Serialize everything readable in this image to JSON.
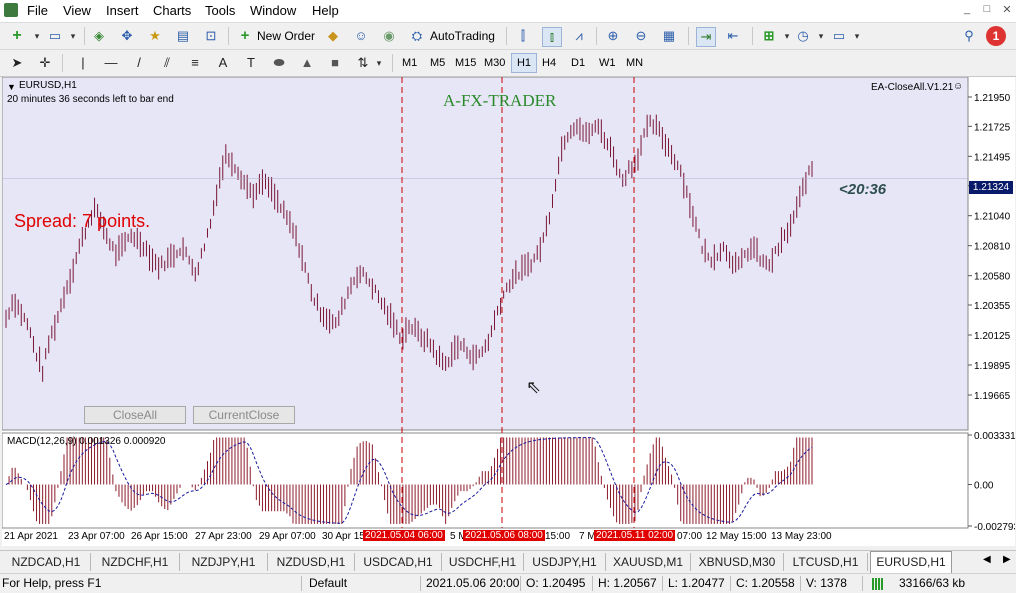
{
  "menu": {
    "items": [
      "File",
      "View",
      "Insert",
      "Charts",
      "Tools",
      "Window",
      "Help"
    ],
    "window_controls": [
      "_",
      "□",
      "✕"
    ]
  },
  "toolbar": {
    "new_order": "New Order",
    "autotrading": "AutoTrading",
    "notification_count": "1"
  },
  "timeframes": [
    "M1",
    "M5",
    "M15",
    "M30",
    "H1",
    "H4",
    "D1",
    "W1",
    "MN"
  ],
  "timeframe_active": "H1",
  "chart": {
    "symbol_label": "EURUSD,H1",
    "countdown": "20 minutes 36 seconds left to bar end",
    "watermark": "A-FX-TRADER",
    "ea_name": "EA-CloseAll.V1.21",
    "spread": "Spread: 7 points.",
    "timer": "<20:36",
    "close_all": "CloseAll",
    "current_close": "CurrentClose",
    "macd_label": "MACD(12,26,9) 0.001326 0.000920",
    "current_price": "1.21324",
    "price_ticks": [
      "1.21950",
      "1.21725",
      "1.21495",
      "1.21270",
      "1.21040",
      "1.20810",
      "1.20580",
      "1.20355",
      "1.20125",
      "1.19895",
      "1.19665"
    ],
    "macd_ticks": [
      "0.003331",
      "0.00",
      "-0.002793"
    ],
    "time_labels": [
      "21 Apr 2021",
      "23 Apr 07:00",
      "26 Apr 15:00",
      "27 Apr 23:00",
      "29 Apr 07:00",
      "30 Apr 15:00",
      "5 M",
      "15:00",
      "7 M",
      "07:00",
      "12 May 15:00",
      "13 May 23:00"
    ],
    "vline_labels": [
      "2021.05.04 06:00",
      "2021.05.06 08:00",
      "2021.05.11 02:00"
    ],
    "colors": {
      "bars": "#7a1535",
      "vline": "#cc0000",
      "watermark": "#2a8a2a",
      "spread": "#e00000",
      "timer": "#2f4f4f",
      "macd_hist": "#8b1a2a",
      "macd_signal": "#1a1aa0",
      "price_tag_bg": "#0a1a6a"
    }
  },
  "symbol_tabs": [
    "NZDCAD,H1",
    "NZDCHF,H1",
    "NZDJPY,H1",
    "NZDUSD,H1",
    "USDCAD,H1",
    "USDCHF,H1",
    "USDJPY,H1",
    "XAUUSD,M1",
    "XBNUSD,M30",
    "LTCUSD,H1",
    "EURUSD,H1"
  ],
  "symbol_tab_active": "EURUSD,H1",
  "status": {
    "help": "For Help, press F1",
    "profile": "Default",
    "datetime": "2021.05.06 20:00",
    "open": "O: 1.20495",
    "high": "H: 1.20567",
    "low": "L: 1.20477",
    "close": "C: 1.20558",
    "volume": "V: 1378",
    "traffic": "33166/63 kb"
  },
  "chart_data": {
    "type": "candlestick-bars",
    "title": "EURUSD,H1",
    "ylim": [
      1.19665,
      1.2195
    ],
    "price_path": [
      1.2025,
      1.204,
      1.203,
      1.202,
      1.2,
      1.1985,
      1.201,
      1.2025,
      1.2045,
      1.206,
      1.208,
      1.2095,
      1.211,
      1.21,
      1.2085,
      1.2075,
      1.208,
      1.209,
      1.2085,
      1.208,
      1.207,
      1.2065,
      1.207,
      1.2075,
      1.208,
      1.207,
      1.206,
      1.208,
      1.21,
      1.213,
      1.215,
      1.2145,
      1.2135,
      1.2125,
      1.212,
      1.213,
      1.2125,
      1.2115,
      1.2105,
      1.2095,
      1.208,
      1.206,
      1.204,
      1.203,
      1.2025,
      1.202,
      1.2035,
      1.205,
      1.206,
      1.2058,
      1.205,
      1.204,
      1.203,
      1.202,
      1.201,
      1.202,
      1.2015,
      1.201,
      1.2005,
      1.1995,
      1.199,
      1.2,
      1.2005,
      1.2,
      1.1995,
      1.2,
      1.201,
      1.203,
      1.2045,
      1.2055,
      1.206,
      1.2065,
      1.207,
      1.208,
      1.21,
      1.213,
      1.216,
      1.217,
      1.2175,
      1.2165,
      1.217,
      1.2172,
      1.216,
      1.215,
      1.213,
      1.214,
      1.2145,
      1.2165,
      1.2175,
      1.217,
      1.216,
      1.215,
      1.214,
      1.212,
      1.21,
      1.208,
      1.207,
      1.2075,
      1.208,
      1.207,
      1.2065,
      1.2075,
      1.208,
      1.207,
      1.2065,
      1.2075,
      1.2085,
      1.2095,
      1.211,
      1.213,
      1.214
    ]
  }
}
